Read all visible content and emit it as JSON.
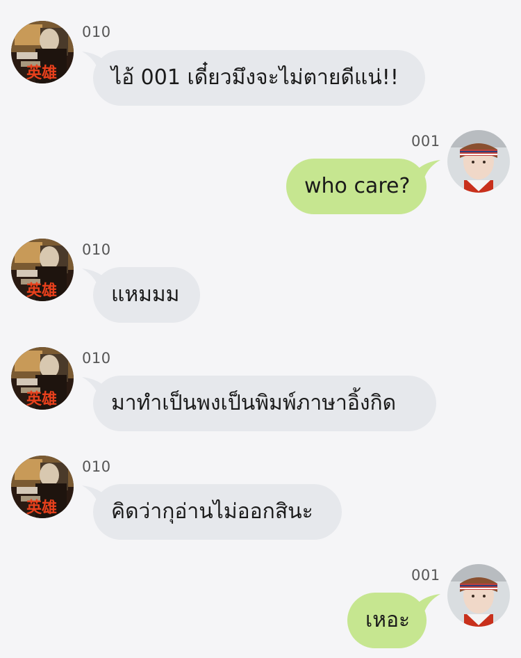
{
  "colors": {
    "background": "#f5f5f7",
    "incoming_bubble": "#e6e8ec",
    "outgoing_bubble": "#c6e690"
  },
  "messages": [
    {
      "sender": "010",
      "direction": "incoming",
      "text": "ไอ้ 001 เดี๋ยวมึงจะไม่ตายดีแน่!!",
      "avatar": "poster-avatar-icon"
    },
    {
      "sender": "001",
      "direction": "outgoing",
      "text": "who care?",
      "avatar": "headband-avatar-icon"
    },
    {
      "sender": "010",
      "direction": "incoming",
      "text": "แหมมม",
      "avatar": "poster-avatar-icon"
    },
    {
      "sender": "010",
      "direction": "incoming",
      "text": "มาทำเป็นพงเป็นพิมพ์ภาษาอิ้งกิด",
      "avatar": "poster-avatar-icon"
    },
    {
      "sender": "010",
      "direction": "incoming",
      "text": "คิดว่ากุอ่านไม่ออกสินะ",
      "avatar": "poster-avatar-icon"
    },
    {
      "sender": "001",
      "direction": "outgoing",
      "text": "เหอะ",
      "avatar": "headband-avatar-icon"
    }
  ]
}
